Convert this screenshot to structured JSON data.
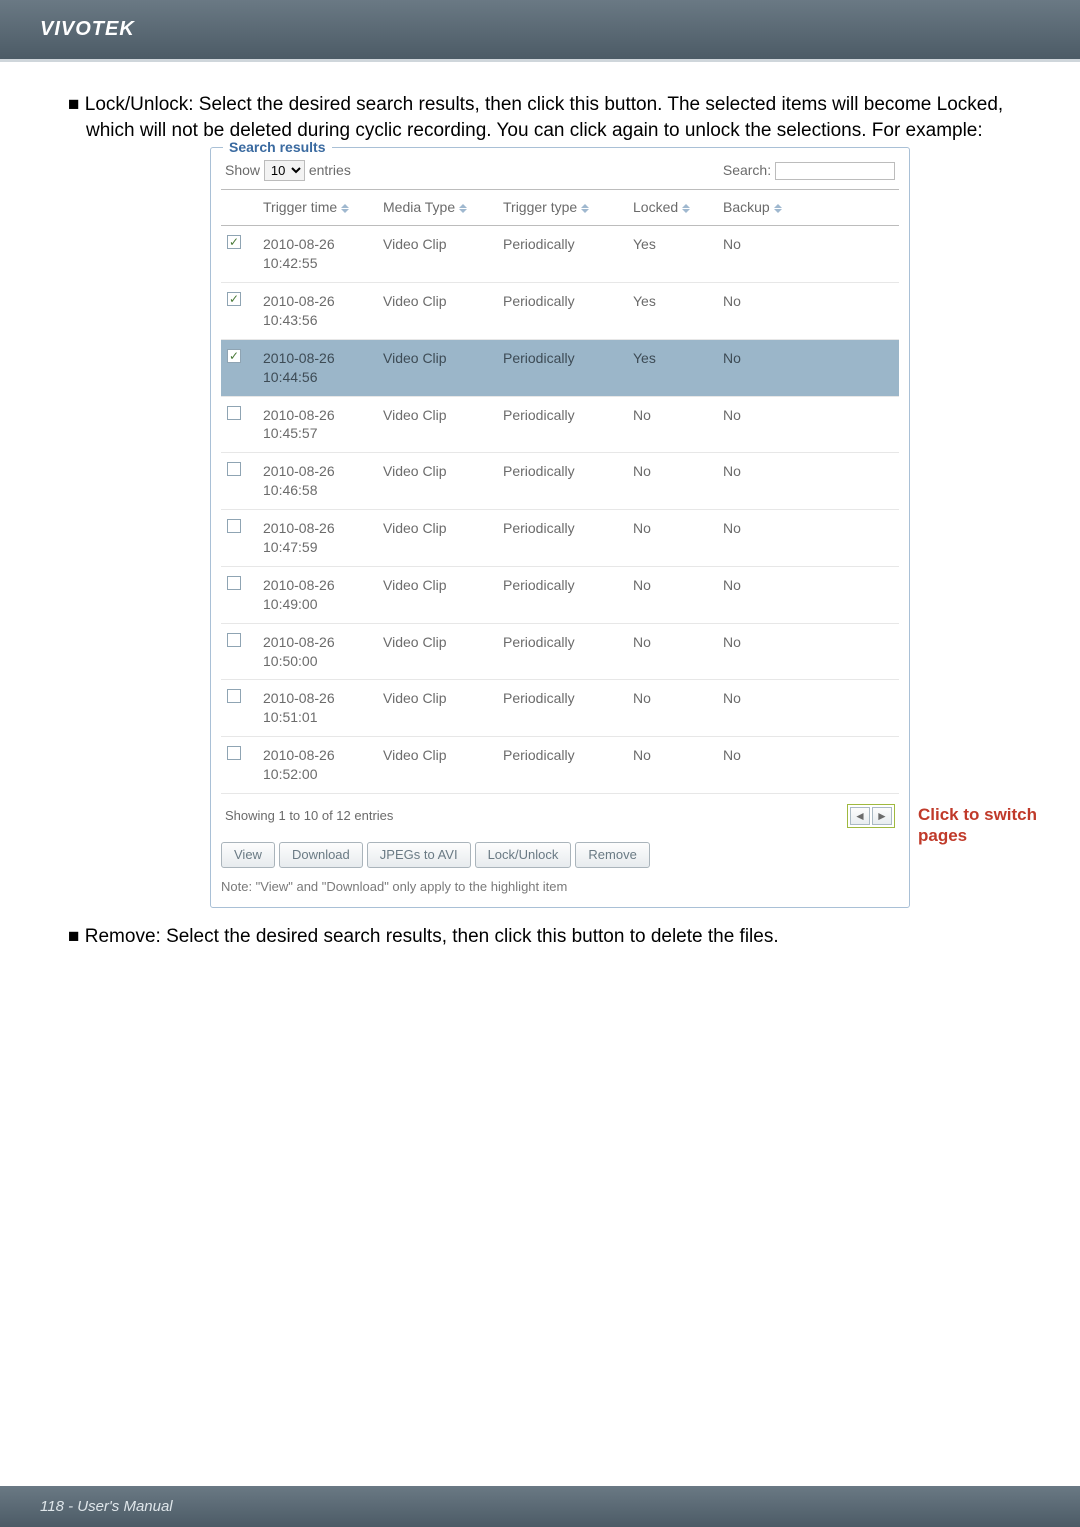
{
  "header": {
    "brand": "VIVOTEK"
  },
  "body": {
    "lock_unlock_bullet": "Lock/Unlock: Select the desired search results, then click this button. The selected items will become Locked, which will not be deleted during cyclic recording. You can click again to unlock the selections. For example:",
    "remove_bullet": "Remove: Select the desired search results, then click this button to delete the files."
  },
  "panel": {
    "title": "Search results",
    "show_label_pre": "Show",
    "show_value": "10",
    "show_label_post": "entries",
    "search_label": "Search:",
    "columns": {
      "checkbox": "",
      "trigger_time": "Trigger time",
      "media_type": "Media Type",
      "trigger_type": "Trigger type",
      "locked": "Locked",
      "backup": "Backup"
    },
    "rows": [
      {
        "checked": true,
        "highlight": false,
        "trigger_time": "2010-08-26 10:42:55",
        "media_type": "Video Clip",
        "trigger_type": "Periodically",
        "locked": "Yes",
        "backup": "No"
      },
      {
        "checked": true,
        "highlight": false,
        "trigger_time": "2010-08-26 10:43:56",
        "media_type": "Video Clip",
        "trigger_type": "Periodically",
        "locked": "Yes",
        "backup": "No"
      },
      {
        "checked": true,
        "highlight": true,
        "trigger_time": "2010-08-26 10:44:56",
        "media_type": "Video Clip",
        "trigger_type": "Periodically",
        "locked": "Yes",
        "backup": "No"
      },
      {
        "checked": false,
        "highlight": false,
        "trigger_time": "2010-08-26 10:45:57",
        "media_type": "Video Clip",
        "trigger_type": "Periodically",
        "locked": "No",
        "backup": "No"
      },
      {
        "checked": false,
        "highlight": false,
        "trigger_time": "2010-08-26 10:46:58",
        "media_type": "Video Clip",
        "trigger_type": "Periodically",
        "locked": "No",
        "backup": "No"
      },
      {
        "checked": false,
        "highlight": false,
        "trigger_time": "2010-08-26 10:47:59",
        "media_type": "Video Clip",
        "trigger_type": "Periodically",
        "locked": "No",
        "backup": "No"
      },
      {
        "checked": false,
        "highlight": false,
        "trigger_time": "2010-08-26 10:49:00",
        "media_type": "Video Clip",
        "trigger_type": "Periodically",
        "locked": "No",
        "backup": "No"
      },
      {
        "checked": false,
        "highlight": false,
        "trigger_time": "2010-08-26 10:50:00",
        "media_type": "Video Clip",
        "trigger_type": "Periodically",
        "locked": "No",
        "backup": "No"
      },
      {
        "checked": false,
        "highlight": false,
        "trigger_time": "2010-08-26 10:51:01",
        "media_type": "Video Clip",
        "trigger_type": "Periodically",
        "locked": "No",
        "backup": "No"
      },
      {
        "checked": false,
        "highlight": false,
        "trigger_time": "2010-08-26 10:52:00",
        "media_type": "Video Clip",
        "trigger_type": "Periodically",
        "locked": "No",
        "backup": "No"
      }
    ],
    "footer_showing": "Showing 1 to 10 of 12 entries",
    "buttons": {
      "view": "View",
      "download": "Download",
      "jpegs_to_avi": "JPEGs to AVI",
      "lock_unlock": "Lock/Unlock",
      "remove": "Remove"
    },
    "note": "Note: \"View\" and \"Download\" only apply to the highlight item",
    "callout": "Click to switch pages"
  },
  "footer": {
    "text": "118 - User's Manual"
  }
}
